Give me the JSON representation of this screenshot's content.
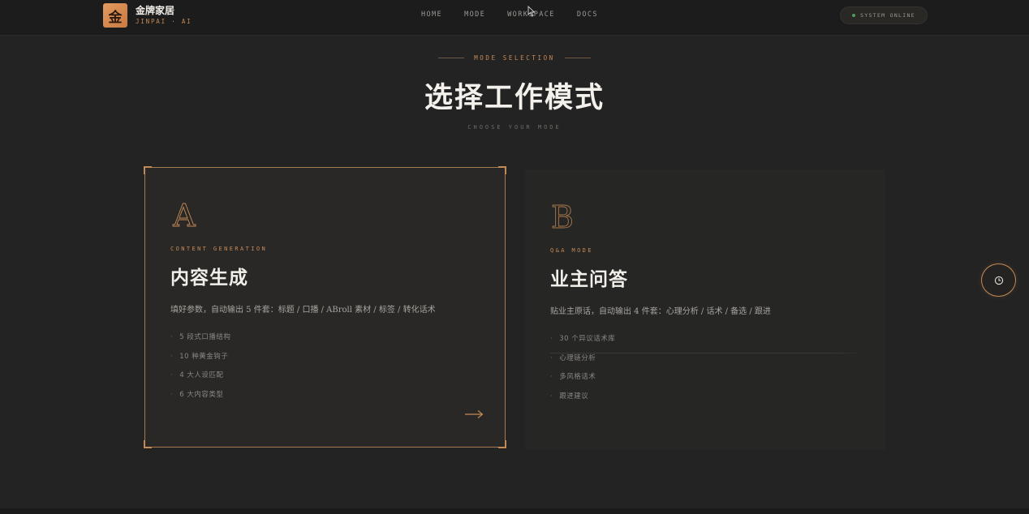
{
  "brand": {
    "logo_char": "金",
    "name": "金牌家居",
    "subtitle": "JINPAI · AI"
  },
  "nav": {
    "items": [
      "HOME",
      "MODE",
      "WORKSPACE",
      "DOCS"
    ]
  },
  "status": {
    "label": "SYSTEM ONLINE",
    "color": "#4e9a5a"
  },
  "heading": {
    "eyebrow": "MODE SELECTION",
    "title": "选择工作模式",
    "subtitle": "CHOOSE YOUR MODE"
  },
  "cards": [
    {
      "letter": "A",
      "kicker": "CONTENT GENERATION",
      "title": "内容生成",
      "description": "填好参数，自动输出 5 件套：标题 / 口播 / ABroll 素材 / 标签 / 转化话术",
      "features": [
        "5 段式口播结构",
        "10 种黄金钩子",
        "4 大人设匹配",
        "6 大内容类型"
      ],
      "selected": true
    },
    {
      "letter": "B",
      "kicker": "Q&A MODE",
      "title": "业主问答",
      "description": "贴业主原话，自动输出 4 件套：心理分析 / 话术 / 备选 / 跟进",
      "features": [
        "30 个异议话术库",
        "心理链分析",
        "多风格话术",
        "跟进建议"
      ],
      "selected": false
    }
  ],
  "colors": {
    "accent": "#c48a55",
    "background": "#232323",
    "topbar": "#1c1c1c"
  }
}
